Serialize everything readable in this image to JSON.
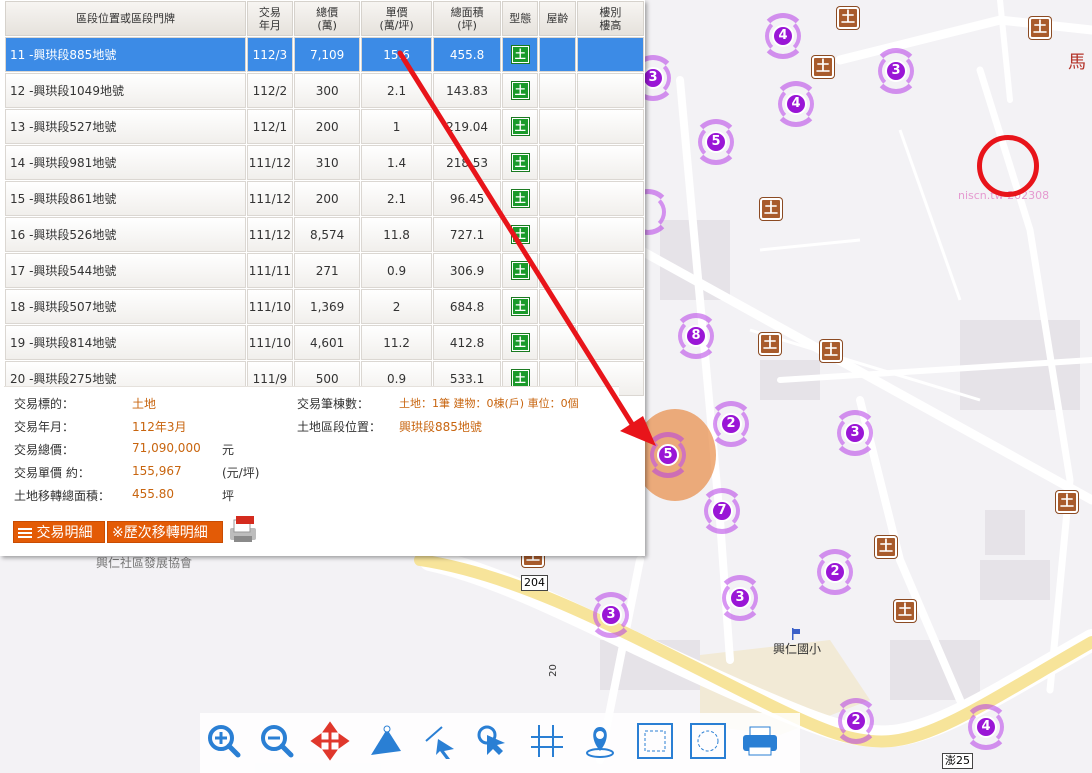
{
  "table": {
    "headers": [
      "區段位置或區段門牌",
      "交易\n年月",
      "總價\n(萬)",
      "單價\n(萬/坪)",
      "總面積\n(坪)",
      "型態",
      "屋齡",
      "樓別\n樓高"
    ],
    "rows": [
      {
        "addr": "11 -興珙段885地號",
        "ym": "112/3",
        "total": "7,109",
        "unit": "15.6",
        "area": "455.8",
        "type": "土",
        "selected": true
      },
      {
        "addr": "12 -興珙段1049地號",
        "ym": "112/2",
        "total": "300",
        "unit": "2.1",
        "area": "143.83",
        "type": "土"
      },
      {
        "addr": "13 -興珙段527地號",
        "ym": "112/1",
        "total": "200",
        "unit": "1",
        "area": "219.04",
        "type": "土"
      },
      {
        "addr": "14 -興珙段981地號",
        "ym": "111/12",
        "total": "310",
        "unit": "1.4",
        "area": "218.53",
        "type": "土"
      },
      {
        "addr": "15 -興珙段861地號",
        "ym": "111/12",
        "total": "200",
        "unit": "2.1",
        "area": "96.45",
        "type": "土"
      },
      {
        "addr": "16 -興珙段526地號",
        "ym": "111/12",
        "total": "8,574",
        "unit": "11.8",
        "area": "727.1",
        "type": "土"
      },
      {
        "addr": "17 -興珙段544地號",
        "ym": "111/11",
        "total": "271",
        "unit": "0.9",
        "area": "306.9",
        "type": "土"
      },
      {
        "addr": "18 -興珙段507地號",
        "ym": "111/10",
        "total": "1,369",
        "unit": "2",
        "area": "684.8",
        "type": "土"
      },
      {
        "addr": "19 -興珙段814地號",
        "ym": "111/10",
        "total": "4,601",
        "unit": "11.2",
        "area": "412.8",
        "type": "土"
      },
      {
        "addr": "20 -興珙段275地號",
        "ym": "111/9",
        "total": "500",
        "unit": "0.9",
        "area": "533.1",
        "type": "土"
      }
    ]
  },
  "detail": {
    "target_label": "交易標的：",
    "target_value": "土地",
    "ym_label": "交易年月：",
    "ym_value": "112年3月",
    "total_label": "交易總價：",
    "total_value": "71,090,000",
    "total_unit": "元",
    "unit_label": "交易單價 約：",
    "unit_value": "155,967",
    "unit_unit": "(元/坪)",
    "area_label": "土地移轉總面積：",
    "area_value": "455.80",
    "area_unit": "坪",
    "count_label": "交易筆棟數：",
    "count_value": "土地：1筆 建物：0棟(戶) 車位：0個",
    "loc_label": "土地區段位置：",
    "loc_value": "興珙段885地號",
    "btn_detail": "交易明細",
    "btn_history": "※歷次移轉明細"
  },
  "map": {
    "label_school": "興仁國小",
    "label_assoc": "興仁社區發展協會",
    "label_ma": "馬",
    "road_204": "204",
    "road_20": "20",
    "road_pen25": "澎25",
    "watermark": "niscn.tw 202308",
    "land_glyph": "土",
    "clusters": [
      "4",
      "3",
      "3",
      "4",
      "5",
      "8",
      "2",
      "3",
      "5",
      "7",
      "2",
      "3",
      "3",
      "2",
      "4"
    ]
  },
  "toolbar": {
    "icons": [
      "zoom-in-icon",
      "zoom-out-icon",
      "pan-icon",
      "measure-area-icon",
      "measure-line-icon",
      "select-icon",
      "crosshair-icon",
      "locate-icon",
      "print-area-icon",
      "print-select-icon",
      "printer-icon"
    ]
  },
  "colors": {
    "selected_row": "#3c8be6",
    "cluster": "#9a16d6",
    "land_marker": "#a85b2c",
    "highlight_circle": "#e8852a",
    "annotation_red": "#e8141a",
    "value_orange": "#c8650f",
    "button_orange": "#e35b06"
  }
}
